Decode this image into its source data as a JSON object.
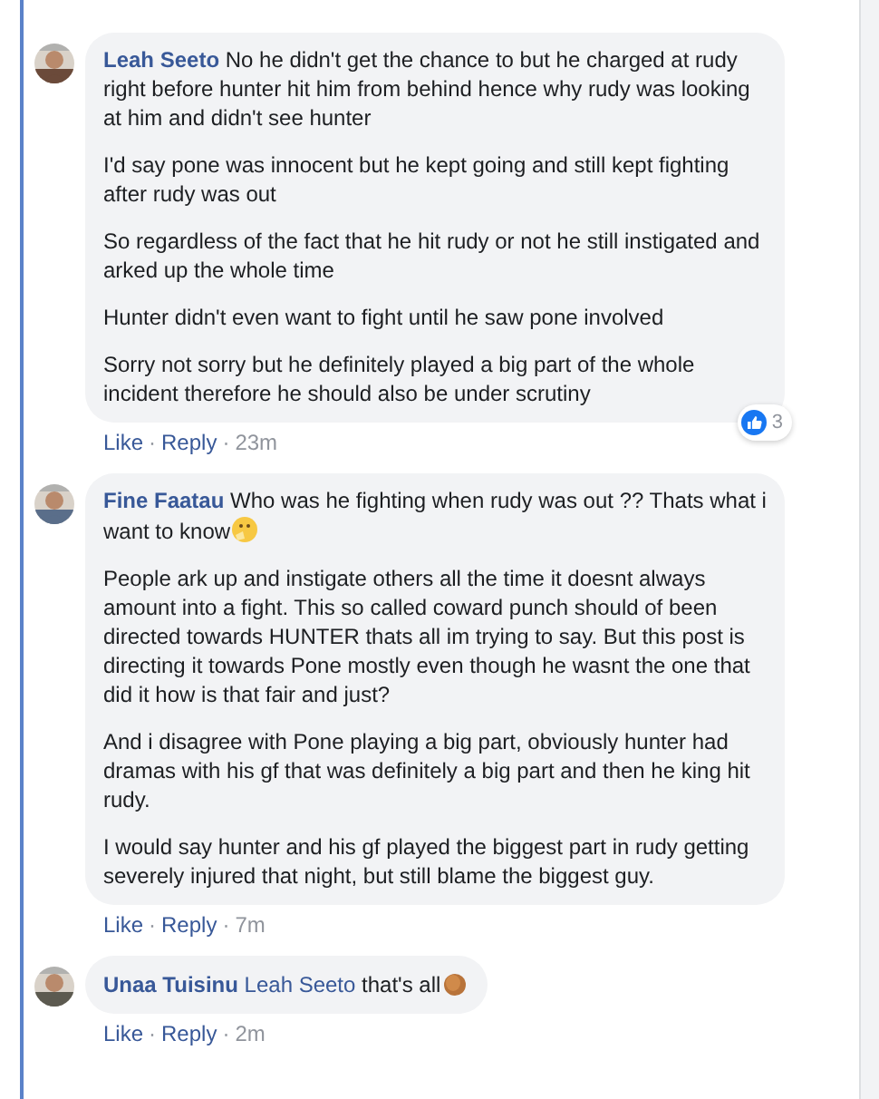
{
  "comments": [
    {
      "author": "Leah Seeto",
      "avatar": {
        "kind": "picture"
      },
      "paragraphs": [
        "No he didn't get the chance to but he charged at rudy right before hunter hit him from behind hence why rudy was looking at him and didn't see hunter",
        "I'd say pone was innocent but he kept going and still kept fighting after rudy was out",
        "So regardless of the fact that he hit rudy or not he still instigated and arked up the whole time",
        "Hunter didn't even want to fight until he saw pone involved",
        "Sorry not sorry but he definitely played a big part of the whole incident therefore he should also be under scrutiny"
      ],
      "actions": {
        "like": "Like",
        "separators": [
          "·",
          "·"
        ],
        "reply": "Reply",
        "time": "23m"
      },
      "reactions": {
        "count": "3"
      }
    },
    {
      "author": "Fine Faatau",
      "avatar": {
        "kind": "picture"
      },
      "paragraphs": [
        "Who was he fighting when rudy was out ?? Thats what i want to know",
        "People ark up and instigate others all the time it doesnt always amount into a fight. This so called coward punch should of been directed towards HUNTER thats all im trying to say. But this post is directing it towards Pone mostly even though he wasnt the one that did it how is that fair and just?",
        "And i disagree with Pone playing a big part, obviously hunter had dramas with his gf that was definitely a big part and then he king hit rudy.",
        "I would say hunter and his gf played the biggest part in rudy getting severely injured that night, but still blame the biggest guy."
      ],
      "emoji": {
        "kind": "thinking"
      },
      "actions": {
        "like": "Like",
        "separators": [
          "·",
          "·"
        ],
        "reply": "Reply",
        "time": "7m"
      }
    },
    {
      "author": "Unaa Tuisinu",
      "mention": "Leah Seeto",
      "avatar": {
        "kind": "picture"
      },
      "paragraphs": [
        "that's all"
      ],
      "emoji": {
        "kind": "clap"
      },
      "actions": {
        "like": "Like",
        "separators": [
          "·",
          "·"
        ],
        "reply": "Reply",
        "time": "2m"
      }
    }
  ]
}
